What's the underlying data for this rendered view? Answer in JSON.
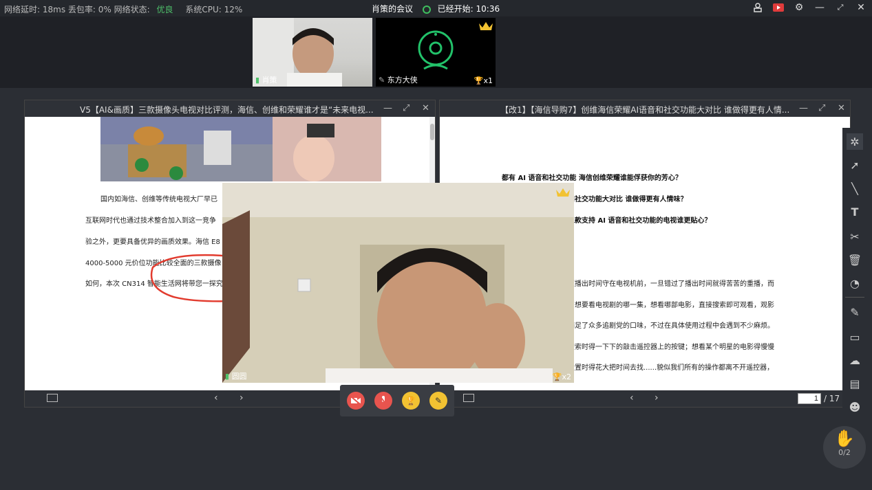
{
  "topbar": {
    "latency": "网络延时: 18ms",
    "loss": "丢包率: 0%",
    "net_label": "网络状态:",
    "net_value": "优良",
    "cpu": "系统CPU: 12%",
    "meeting_title": "肖策的会议",
    "started": "已经开始: 10:36"
  },
  "participants": [
    {
      "name": "肖策"
    },
    {
      "name": "东方大侠",
      "trophy_count": "x1"
    }
  ],
  "doc_left": {
    "title": "V5【AI&画质】三款摄像头电视对比评测，海信、创维和荣耀谁才是“未来电视...",
    "lines": [
      "国内如海信、创维等传统电视大厂早已",
      "互联网时代也通过技术整合加入到这一竞争",
      "验之外，更要具备优异的画质效果。海信 E8",
      "4000-5000 元价位功能比较全面的三款摄像",
      "如何，本次 CN314 智能生活网将带您一探究"
    ]
  },
  "doc_right": {
    "title": "【改1】【海信导购7】创维海信荣耀AI语音和社交功能大对比 谁做得更有人情...",
    "headings": [
      "都有 AI 语音和社交功能 海信创维荣耀谁能俘获你的芳心？",
      "和社交功能大对比 谁做得更有人情味？",
      "三款支持 AI 语音和社交功能的电视谁更贴心？"
    ],
    "lines": [
      "照播出时间守在电视机前，一旦错过了播出时间就得苦苦的重播，而",
      "，想要看电视剧的哪一集，想看哪部电影，直接搜索即可观看，观影",
      "满足了众多追剧党的口味，不过在具体使用过程中会遇到不少麻烦。",
      "搜索时得一下下的敲击遥控器上的按键；想看某个明星的电影得慢慢",
      "设置时得花大把时间去找......貌似我们所有的操作都离不开遥控器，"
    ],
    "page_current": "1",
    "page_total": "/ 17"
  },
  "floating_video": {
    "name": "圆圆",
    "trophy_count": "x2"
  },
  "hand": {
    "count": "0/2"
  },
  "colors": {
    "accent_green": "#4ec06a",
    "red_button": "#e8544e",
    "yellow_button": "#f2c232"
  }
}
